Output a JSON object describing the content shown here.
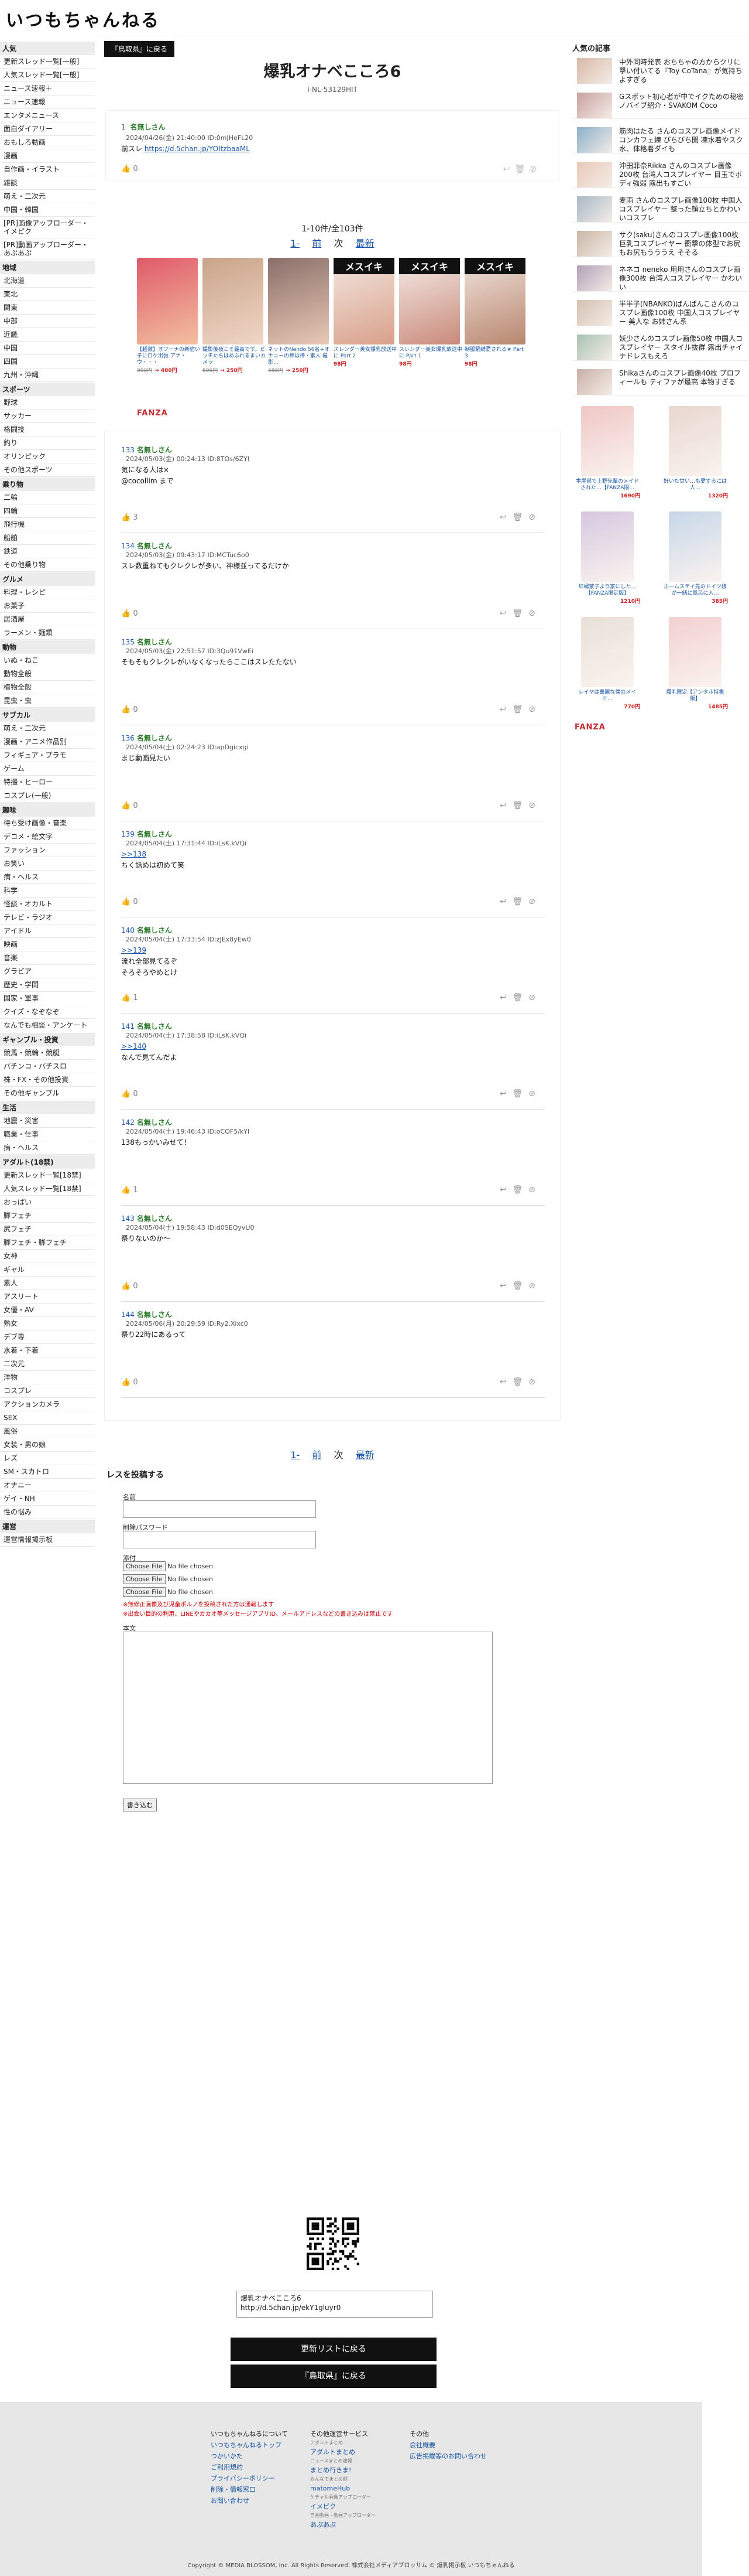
{
  "site": {
    "logo": "いつもちゃんねる"
  },
  "nav": [
    {
      "head": "人気",
      "items": [
        "更新スレッド一覧[一般]",
        "人気スレッド一覧[一般]",
        "ニュース速報＋",
        "ニュース速報",
        "エンタメニュース",
        "面白ダイアリー",
        "おもしろ動画",
        "漫画",
        "自作画・イラスト",
        "雑談",
        "萌え・二次元",
        "中国・韓国",
        "[PR]画像アップローダー・イメピク",
        "[PR]動画アップローダー・あぷあぷ"
      ]
    },
    {
      "head": "地域",
      "items": [
        "北海道",
        "東北",
        "関東",
        "中部",
        "近畿",
        "中国",
        "四国",
        "九州・沖縄"
      ]
    },
    {
      "head": "スポーツ",
      "items": [
        "野球",
        "サッカー",
        "格闘技",
        "釣り",
        "オリンピック",
        "その他スポーツ"
      ]
    },
    {
      "head": "乗り物",
      "items": [
        "二輪",
        "四輪",
        "飛行機",
        "船舶",
        "鉄道",
        "その他乗り物"
      ]
    },
    {
      "head": "グルメ",
      "items": [
        "料理・レシピ",
        "お菓子",
        "居酒屋",
        "ラーメン・麺類"
      ]
    },
    {
      "head": "動物",
      "items": [
        "いぬ・ねこ",
        "動物全般",
        "植物全般",
        "昆虫・虫"
      ]
    },
    {
      "head": "サブカル",
      "items": [
        "萌え・二次元",
        "漫画・アニメ作品別",
        "フィギュア・プラモ",
        "ゲーム",
        "特撮・ヒーロー",
        "コスプレ(一般)"
      ]
    },
    {
      "head": "趣味",
      "items": [
        "待ち受け画像・音楽",
        "デコメ・絵文字",
        "ファッション",
        "お笑い",
        "病・ヘルス",
        "科学",
        "怪談・オカルト",
        "テレビ・ラジオ",
        "アイドル",
        "映画",
        "音楽",
        "グラビア",
        "歴史・学問",
        "国家・軍事",
        "クイズ・なぞなぞ",
        "なんでも相談・アンケート"
      ]
    },
    {
      "head": "ギャンブル・投資",
      "items": [
        "競馬・競輪・競艇",
        "パチンコ・パチスロ",
        "株・FX・その他投資",
        "その他ギャンブル"
      ]
    },
    {
      "head": "生活",
      "items": [
        "地震・災害",
        "職業・仕事",
        "病・ヘルス"
      ]
    },
    {
      "head": "アダルト(18禁)",
      "items": [
        "更新スレッド一覧[18禁]",
        "人気スレッド一覧[18禁]",
        "おっぱい",
        "脚フェチ",
        "尻フェチ",
        "脚フェチ・脚フェチ",
        "女神",
        "ギャル",
        "素人",
        "アスリート",
        "女優・AV",
        "熟女",
        "デブ専",
        "水着・下着",
        "二次元",
        "洋物",
        "コスプレ",
        "アクションカメラ",
        "SEX",
        "風俗",
        "女装・男の娘",
        "レズ",
        "SM・スカトロ",
        "オナニー",
        "ゲイ・NH",
        "性の悩み"
      ]
    },
    {
      "head": "運営",
      "items": [
        "運営情報掲示板"
      ]
    }
  ],
  "thread": {
    "back_label": "『鳥取県』に戻る",
    "title": "爆乳オナベこころ6",
    "id": "I-NL-53129HIT"
  },
  "first_post": {
    "num": "1",
    "name": "名無しさん",
    "meta": "2024/04/26(金) 21:40:00 ID:0mJHeFL20",
    "body": "前スレ",
    "link": "https://d.5chan.jp/YOItzbaaML",
    "likes": "0"
  },
  "pager": {
    "range": "1-10件/全103件",
    "first": "1-",
    "prev": "前",
    "next": "次",
    "latest": "最新"
  },
  "ads": [
    {
      "caption": "【超激】オフーナの新宿い子にロケ出張 アナ・ウ・・・",
      "price_old": "900円",
      "price": "→ 480円"
    },
    {
      "caption": "撮影後夜こそ最高です。ビッチたちはあふれるまいカメラ",
      "price_old": "500円",
      "price": "→ 250円"
    },
    {
      "caption": "ネットのNendo 56名+オナニーの神は神・素人 撮影...",
      "price_old": "480円",
      "price": "→ 250円"
    },
    {
      "caption": "スレンダー美女爆乳放送中に Part 2",
      "price_old": "",
      "price": "98円"
    },
    {
      "caption": "スレンダー美女爆乳放送中に Part 1",
      "price_old": "",
      "price": "98円"
    },
    {
      "caption": "制服緊縛愛される★ Part 3",
      "price_old": "",
      "price": "98円"
    }
  ],
  "ads_label": "FANZA",
  "posts": [
    {
      "num": "133",
      "name": "名無しさん",
      "meta": "2024/05/03(金) 00:24:13 ID:8TOs/6ZYl",
      "body": [
        "気になる人は×",
        "@cocollim まで"
      ],
      "likes": "3"
    },
    {
      "num": "134",
      "name": "名無しさん",
      "meta": "2024/05/03(金) 09:43:17 ID:MCTuc6o0",
      "body": [
        "スレ数重ねてもクレクレが多い、神様並ってるだけか"
      ],
      "likes": "0"
    },
    {
      "num": "135",
      "name": "名無しさん",
      "meta": "2024/05/03(金) 22:51:57 ID:3Qu91VwEi",
      "body": [
        "そもそもクレクレがいなくなったらここはスレたたない"
      ],
      "likes": "0"
    },
    {
      "num": "136",
      "name": "名無しさん",
      "meta": "2024/05/04(土) 02:24:23 ID:apDgicxgi",
      "body": [
        "まじ動画見たい"
      ],
      "likes": "0"
    },
    {
      "num": "139",
      "name": "名無しさん",
      "meta": "2024/05/04(土) 17:31:44 ID:iLsK.kVQi",
      "anchor": ">>138",
      "body": [
        "ちく話めは初めて笑"
      ],
      "likes": "0"
    },
    {
      "num": "140",
      "name": "名無しさん",
      "meta": "2024/05/04(土) 17:33:54 ID:zJEx8yEw0",
      "anchor": ">>139",
      "body": [
        "流れ全部見てるぞ",
        "そろそろやめとけ"
      ],
      "likes": "1"
    },
    {
      "num": "141",
      "name": "名無しさん",
      "meta": "2024/05/04(土) 17:38:58 ID:iLsK.kVQi",
      "anchor": ">>140",
      "body": [
        "なんで見てんだよ"
      ],
      "likes": "0"
    },
    {
      "num": "142",
      "name": "名無しさん",
      "meta": "2024/05/04(土) 19:46:43 ID:oCOF5/kYl",
      "body": [
        "138もっかいみせて！"
      ],
      "likes": "1"
    },
    {
      "num": "143",
      "name": "名無しさん",
      "meta": "2024/05/04(土) 19:58:43 ID:d0SEQyvU0",
      "body": [
        "祭りないのか～"
      ],
      "likes": "0"
    },
    {
      "num": "144",
      "name": "名無しさん",
      "meta": "2024/05/06(月) 20:29:59 ID:Ry2.Xixc0",
      "body": [
        "祭り22時にあるって"
      ],
      "likes": "0"
    }
  ],
  "form": {
    "title": "レスを投稿する",
    "name_label": "名前",
    "delete_label": "削除パスワード",
    "attach_label": "添付",
    "choose_file": "Choose File",
    "no_file": "No file chosen",
    "warn1": "※無修正画像及び児童ポルノを投稿された方は通報します",
    "warn2": "※出会い目的の利用、LINEやカカオ等メッセージアプリID、メールアドレスなどの書き込みは禁止です",
    "body_label": "本文",
    "submit": "書き込む"
  },
  "share": {
    "line1": "爆乳オナベこころ6",
    "line2": "http://d.5chan.jp/ekY1gluyr0"
  },
  "bottom_buttons": {
    "list": "更新リストに戻る",
    "back": "『鳥取県』に戻る"
  },
  "right": {
    "heading": "人気の記事",
    "articles": [
      "中外同時発表 おちちゃの方からクリに撃い付いてる『Toy CoTana』が気持ちよすぎる",
      "Gスポット初心者が中でイクための秘密ノバイブ紹介・SVAKOM Coco",
      "筋肉はたる さんのコスプレ画像メイドコンカフェ練 ぴちぴち開 凍水着やスク水、体格着ダイも",
      "沖田菲奈Rikka さんのコスプレ画像200枚 台湾人コスプレイヤー 目玉でボディ強弱 露出もすごい",
      "麦雨 さんのコスプレ画像100枚 中国人コスプレイヤー 整った顔立ちとかわいいコスプレ",
      "サク(saku)さんのコスプレ画像100枚 巨乳コスプレイヤー 衝撃の体型でお尻もお尻もうううえ そそる",
      "ネネコ neneko 用用さんのコスプレ画像300枚 台湾人コスプレイヤー かわいい",
      "半半子(NBANKO)ぱんぱんこさんのコスプレ画像100枚 中国人コスプレイヤー 美人な お姉さん系",
      "妖少さんのコスプレ画像50枚 中国人コスプレイヤー スタイル抜群 露出チャイナドレスもえろ",
      "Shikaさんのコスプレ画像40枚 プロフィールも ティファが最高 本物すぎる"
    ],
    "ads": [
      {
        "caption": "本屋部で上野先輩のメイドされた…【FANZA限...",
        "price": "1690円"
      },
      {
        "caption": "好いた甘い…も愛するには人…",
        "price": "1320円"
      },
      {
        "caption": "紅螺蒙子より家にした…【FANZA限定版】",
        "price": "1210円"
      },
      {
        "caption": "ホームステイ先のドイツ娘が一緒に風呂に入…",
        "price": "385円"
      },
      {
        "caption": "レイヤは華麗な僕のメイド…",
        "price": "770円"
      },
      {
        "caption": "爆乳限定【アンタル特集版】",
        "price": "1485円"
      }
    ],
    "ads_label": "FANZA"
  },
  "footer": {
    "col1": [
      "いつもちゃんねるについて",
      "いつもちゃんねるトップ",
      "つかいかた",
      "ご利用規約",
      "プライバシーポリシー",
      "削除・情報窓口",
      "お問い合わせ"
    ],
    "col2_head": "その他運営サービス",
    "col2": [
      {
        "sub": "アダルトまとめ",
        "name": "アダルトまとめ"
      },
      {
        "sub": "ニュースまとめ速報",
        "name": "まとめ行きま!"
      },
      {
        "sub": "みんなでまとめ部",
        "name": "matomeHub"
      },
      {
        "sub": "ケチャル画像アップローダー",
        "name": "イメピク"
      },
      {
        "sub": "自画動画 - 動画アップローダー",
        "name": "あぷあぷ"
      }
    ],
    "col3_head": "その他",
    "col3": [
      "会社概要",
      "広告掲載等のお問い合わせ"
    ],
    "copyright": "Copyright © MEDIA BLOSSOM, Inc. All Rights Reserved. 株式会社メディアブロッサム © 爆乳掲示板 いつもちゃんねる"
  },
  "colors": {
    "accent": "#1a57a6",
    "name": "#2b7a2b",
    "warn": "#cc0000",
    "price": "#cc2222"
  }
}
